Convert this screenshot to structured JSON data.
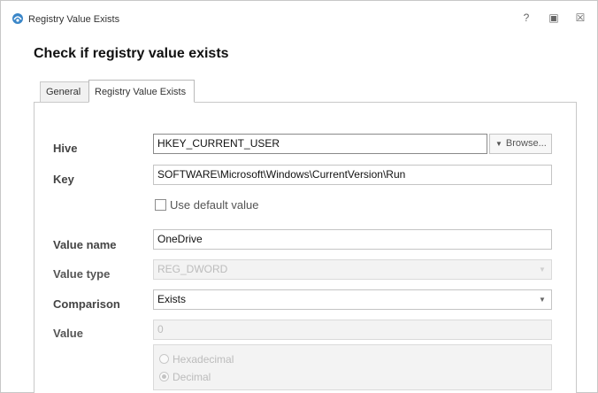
{
  "window": {
    "title": "Registry Value Exists",
    "help_glyph": "?",
    "max_glyph": "▣",
    "close_glyph": "☒"
  },
  "heading": "Check if registry value exists",
  "tabs": [
    {
      "label": "General",
      "active": false
    },
    {
      "label": "Registry Value Exists",
      "active": true
    }
  ],
  "form": {
    "hive": {
      "label": "Hive",
      "value": "HKEY_CURRENT_USER"
    },
    "browse_label": "Browse...",
    "key": {
      "label": "Key",
      "value": "SOFTWARE\\Microsoft\\Windows\\CurrentVersion\\Run"
    },
    "use_default": {
      "label": "Use default value",
      "checked": false
    },
    "value_name": {
      "label": "Value name",
      "value": "OneDrive"
    },
    "value_type": {
      "label": "Value type",
      "value": "REG_DWORD",
      "disabled": true
    },
    "comparison": {
      "label": "Comparison",
      "value": "Exists"
    },
    "value": {
      "label": "Value",
      "value": "0",
      "disabled": true
    },
    "radix": {
      "options": [
        {
          "label": "Hexadecimal",
          "selected": false
        },
        {
          "label": "Decimal",
          "selected": true
        }
      ]
    }
  },
  "icons": {
    "dropdown": "▼"
  }
}
